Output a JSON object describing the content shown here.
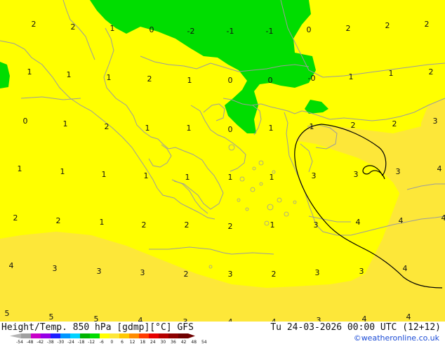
{
  "title": "Height/Temp. 850 hPa [gdmp][°C] GFS",
  "datetime": "Tu 24-03-2026 00:00 UTC (12+12)",
  "credit": "©weatheronline.co.uk",
  "colors": {
    "band_0_to_4": "#ffff00",
    "band_4_to_8": "#fde739",
    "band_minus4_to_0": "#00dd00",
    "coast": "#9c9c9c",
    "isoline": "#000000"
  },
  "values": [
    {
      "t": "2"
    },
    {
      "t": "2"
    },
    {
      "t": "1"
    },
    {
      "t": "0"
    },
    {
      "t": "-2"
    },
    {
      "t": "-1"
    },
    {
      "t": "-1"
    },
    {
      "t": "0"
    },
    {
      "t": "2"
    },
    {
      "t": "2"
    },
    {
      "t": "2"
    },
    {
      "t": "1"
    },
    {
      "t": "1"
    },
    {
      "t": "1"
    },
    {
      "t": "2"
    },
    {
      "t": "1"
    },
    {
      "t": "0"
    },
    {
      "t": "0"
    },
    {
      "t": "-0"
    },
    {
      "t": "1"
    },
    {
      "t": "1"
    },
    {
      "t": "2"
    },
    {
      "t": "0"
    },
    {
      "t": "1"
    },
    {
      "t": "2"
    },
    {
      "t": "1"
    },
    {
      "t": "1"
    },
    {
      "t": "0"
    },
    {
      "t": "1"
    },
    {
      "t": "1"
    },
    {
      "t": "2"
    },
    {
      "t": "2"
    },
    {
      "t": "3"
    },
    {
      "t": "1"
    },
    {
      "t": "1"
    },
    {
      "t": "1"
    },
    {
      "t": "1"
    },
    {
      "t": "1"
    },
    {
      "t": "1"
    },
    {
      "t": "1"
    },
    {
      "t": "3"
    },
    {
      "t": "3"
    },
    {
      "t": "3"
    },
    {
      "t": "4"
    },
    {
      "t": "2"
    },
    {
      "t": "2"
    },
    {
      "t": "1"
    },
    {
      "t": "2"
    },
    {
      "t": "2"
    },
    {
      "t": "2"
    },
    {
      "t": "1"
    },
    {
      "t": "3"
    },
    {
      "t": "4"
    },
    {
      "t": "4"
    },
    {
      "t": "4"
    },
    {
      "t": "4"
    },
    {
      "t": "3"
    },
    {
      "t": "3"
    },
    {
      "t": "3"
    },
    {
      "t": "2"
    },
    {
      "t": "3"
    },
    {
      "t": "2"
    },
    {
      "t": "3"
    },
    {
      "t": "3"
    },
    {
      "t": "4"
    },
    {
      "t": "5"
    },
    {
      "t": "5"
    },
    {
      "t": "5"
    },
    {
      "t": "4"
    },
    {
      "t": "3"
    },
    {
      "t": "4"
    },
    {
      "t": "4"
    },
    {
      "t": "3"
    },
    {
      "t": "4"
    },
    {
      "t": "4"
    }
  ],
  "legend": {
    "ticks": [
      "-54",
      "-48",
      "-42",
      "-38",
      "-30",
      "-24",
      "-18",
      "-12",
      "-6",
      "0",
      "6",
      "12",
      "18",
      "24",
      "30",
      "36",
      "42",
      "48",
      "54"
    ],
    "colors": [
      "#b4b4b4",
      "#a0a0a0",
      "#c800c8",
      "#9600e6",
      "#1e1eff",
      "#0096ff",
      "#00d2ff",
      "#00b400",
      "#00dc00",
      "#ffff00",
      "#fde739",
      "#ffc800",
      "#ff8c00",
      "#ff3c00",
      "#e60000",
      "#b40000",
      "#8c0000",
      "#6e0000"
    ]
  }
}
